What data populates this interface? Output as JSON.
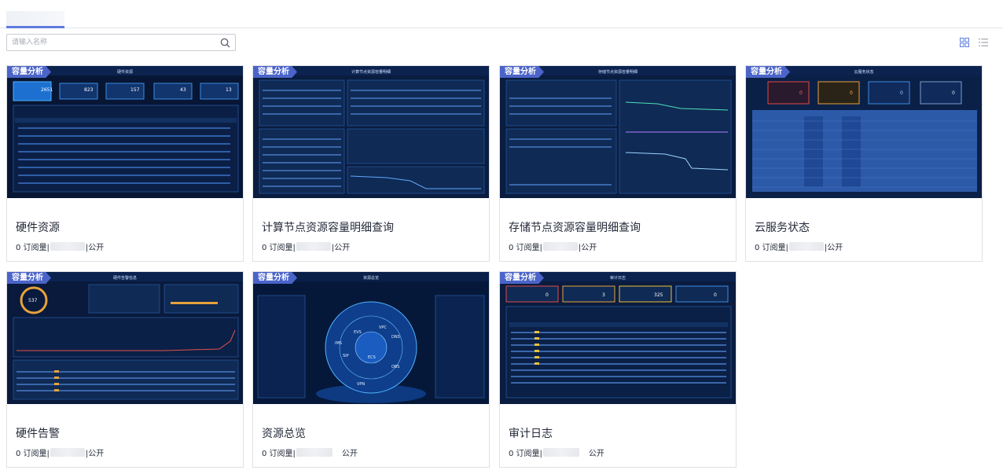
{
  "search": {
    "placeholder": "请输入名称"
  },
  "icons": {
    "search": "search-icon",
    "grid_view": "grid-view-icon",
    "list_view": "list-view-icon"
  },
  "colors": {
    "accent": "#5e7ce0",
    "tag_bg": "#4b64c9",
    "thumb_bg": "#0a1a3a"
  },
  "cards": [
    {
      "tag": "容量分析",
      "title": "硬件资源",
      "subscriptions": "0 订阅量|",
      "visibility": "|公开",
      "preview": {
        "header": "硬件资源",
        "stats": [
          "2651",
          "823",
          "157",
          "43",
          "13"
        ]
      }
    },
    {
      "tag": "容量分析",
      "title": "计算节点资源容量明细查询",
      "subscriptions": "0 订阅量|",
      "visibility": "|公开",
      "preview": {
        "header": "计算节点资源容量明细"
      }
    },
    {
      "tag": "容量分析",
      "title": "存储节点资源容量明细查询",
      "subscriptions": "0 订阅量|",
      "visibility": "|公开",
      "preview": {
        "header": "存储节点资源容量明细"
      }
    },
    {
      "tag": "容量分析",
      "title": "云服务状态",
      "subscriptions": "0 订阅量|",
      "visibility": "|公开",
      "preview": {
        "header": "云服务状态",
        "stats": [
          "0",
          "0",
          "0",
          "0"
        ]
      }
    },
    {
      "tag": "容量分析",
      "title": "硬件告警",
      "subscriptions": "0 订阅量|",
      "visibility": "|公开",
      "preview": {
        "header": "硬件告警信息",
        "gauge": "537"
      }
    },
    {
      "tag": "容量分析",
      "title": "资源总览",
      "subscriptions": "0 订阅量|",
      "visibility": "公开",
      "preview": {
        "header": "资源总览",
        "nodes": [
          "EVS",
          "VPC",
          "ECS",
          "OBS",
          "SIP",
          "VPN",
          "DNS",
          "IMS"
        ]
      }
    },
    {
      "tag": "容量分析",
      "title": "审计日志",
      "subscriptions": "0 订阅量|",
      "visibility": "公开",
      "preview": {
        "header": "审计日志",
        "stats": [
          "0",
          "3",
          "325",
          "0"
        ]
      }
    }
  ]
}
